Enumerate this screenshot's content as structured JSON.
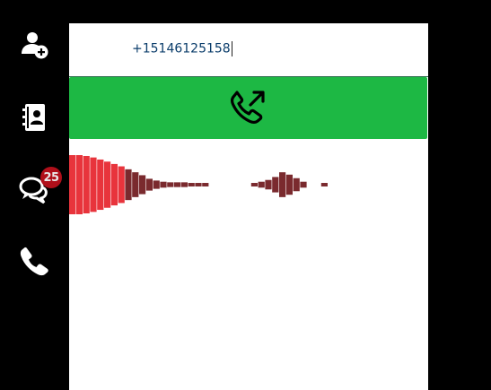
{
  "sidebar": {
    "items": [
      {
        "name": "add-contact",
        "icon": "user-plus-icon"
      },
      {
        "name": "contacts",
        "icon": "address-book-icon"
      },
      {
        "name": "messages",
        "icon": "chat-bubbles-icon",
        "badge": "25"
      },
      {
        "name": "phone",
        "icon": "phone-icon"
      }
    ]
  },
  "dialer": {
    "number_value": "+15146125158",
    "call_button_icon": "phone-outgoing-icon"
  },
  "colors": {
    "call_button": "#1db844",
    "badge": "#b00f1a",
    "wave_red": "#e8343c",
    "wave_dark": "#7a2a2e"
  },
  "audio_meter": {
    "levels": [
      1.0,
      1.0,
      0.97,
      0.92,
      0.85,
      0.78,
      0.7,
      0.62,
      0.52,
      0.42,
      0.32,
      0.2,
      0.14,
      0.1,
      0.08,
      0.08,
      0.08,
      0.06,
      0.06,
      0.06,
      0,
      0,
      0,
      0,
      0,
      0,
      0.06,
      0.1,
      0.16,
      0.26,
      0.42,
      0.34,
      0.22,
      0.1,
      0,
      0,
      0.06
    ]
  }
}
